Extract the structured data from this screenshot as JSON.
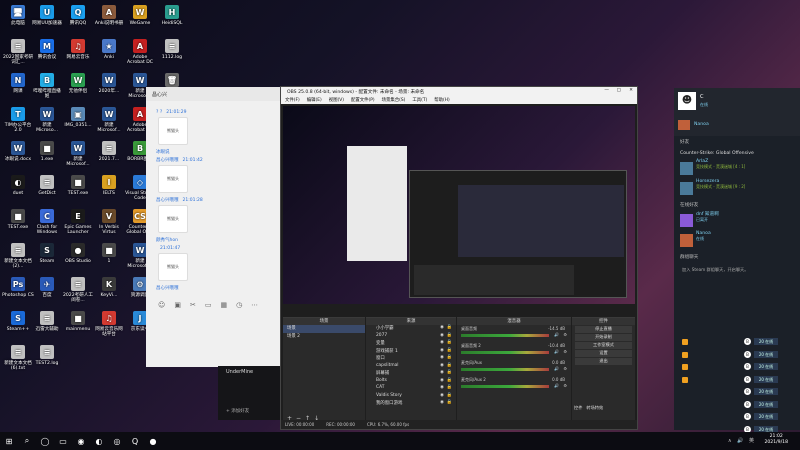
{
  "desktop": {
    "icons": [
      {
        "label": "此电脑",
        "glyph": "🖥",
        "color": "#3a7bd5"
      },
      {
        "label": "网易UU加速器",
        "glyph": "U",
        "color": "#1a9be8"
      },
      {
        "label": "腾讯QQ",
        "glyph": "Q",
        "color": "#1aa0f0"
      },
      {
        "label": "Anki说明书册",
        "glyph": "A",
        "color": "#8b5a3c"
      },
      {
        "label": "WeGame",
        "glyph": "W",
        "color": "#d9a020"
      },
      {
        "label": "HeidiSQL",
        "glyph": "H",
        "color": "#2a9d8f"
      },
      {
        "label": "2022国家考研词汇...",
        "glyph": "≡",
        "color": "#c0c0c0"
      },
      {
        "label": "腾讯会议",
        "glyph": "M",
        "color": "#1a6fe8"
      },
      {
        "label": "网易云音乐",
        "glyph": "♫",
        "color": "#d33a31"
      },
      {
        "label": "Anki",
        "glyph": "★",
        "color": "#4a78c8"
      },
      {
        "label": "Adobe Acrobat DC",
        "glyph": "A",
        "color": "#c42020"
      },
      {
        "label": "1112.log",
        "glyph": "≡",
        "color": "#c0c0c0"
      },
      {
        "label": "网课",
        "glyph": "N",
        "color": "#2266cc"
      },
      {
        "label": "哔哩哔哩直播姬",
        "glyph": "B",
        "color": "#23ade5"
      },
      {
        "label": "无他伴侣",
        "glyph": "W",
        "color": "#2aa050"
      },
      {
        "label": "2020年...",
        "glyph": "W",
        "color": "#2b5797"
      },
      {
        "label": "新建 Microsof...",
        "glyph": "W",
        "color": "#2b5797"
      },
      {
        "label": "回收站",
        "glyph": "🗑",
        "color": "#6a6a6a"
      },
      {
        "label": "TIM办公平台 2.0",
        "glyph": "T",
        "color": "#1a9be8"
      },
      {
        "label": "新建 Microso...",
        "glyph": "W",
        "color": "#2b5797"
      },
      {
        "label": "IMG_0351...",
        "glyph": "▣",
        "color": "#5a8ab8"
      },
      {
        "label": "新建 Microsof...",
        "glyph": "W",
        "color": "#2b5797"
      },
      {
        "label": "Adobe Acrobat DC",
        "glyph": "A",
        "color": "#c42020"
      },
      {
        "label": "Bongo Cat Mver",
        "glyph": "C",
        "color": "#333333"
      },
      {
        "label": "冰眼说.docx",
        "glyph": "W",
        "color": "#2b5797"
      },
      {
        "label": "1.exe",
        "glyph": "■",
        "color": "#4a4a4a"
      },
      {
        "label": "新建 Microsof...",
        "glyph": "W",
        "color": "#2b5797"
      },
      {
        "label": "2021.7...",
        "glyph": "≡",
        "color": "#c0c0c0"
      },
      {
        "label": "BORBR图片",
        "glyph": "B",
        "color": "#3a9a3a"
      },
      {
        "label": "Counter-Strike Global Off...",
        "glyph": "CS",
        "color": "#e39a2a"
      },
      {
        "label": "duet",
        "glyph": "◐",
        "color": "#1a1a1a"
      },
      {
        "label": "GetDict",
        "glyph": "≡",
        "color": "#c0c0c0"
      },
      {
        "label": "TEST.exe",
        "glyph": "■",
        "color": "#4a4a4a"
      },
      {
        "label": "IELTS",
        "glyph": "I",
        "color": "#d9a020"
      },
      {
        "label": "Visual Studio Code",
        "glyph": "◇",
        "color": "#2a7ad8"
      },
      {
        "label": "2.txt",
        "glyph": "≡",
        "color": "#c0c0c0"
      },
      {
        "label": "TEST.exe",
        "glyph": "■",
        "color": "#4a4a4a"
      },
      {
        "label": "Clash for Windows",
        "glyph": "C",
        "color": "#3a6ad8"
      },
      {
        "label": "Epic Games Launcher",
        "glyph": "E",
        "color": "#1a1a1a"
      },
      {
        "label": "In Verbis Virtus",
        "glyph": "V",
        "color": "#6a4a2a"
      },
      {
        "label": "Counter-S Global Off...",
        "glyph": "CS",
        "color": "#e39a2a"
      },
      {
        "label": "新建文本文档(3).txt",
        "glyph": "≡",
        "color": "#c0c0c0"
      },
      {
        "label": "新建文本文档(2)...",
        "glyph": "≡",
        "color": "#c0c0c0"
      },
      {
        "label": "Steam",
        "glyph": "S",
        "color": "#1b2838"
      },
      {
        "label": "OBS Studio",
        "glyph": "●",
        "color": "#2a2a2a"
      },
      {
        "label": "1",
        "glyph": "■",
        "color": "#4a4a4a"
      },
      {
        "label": "新建 Microsoft...",
        "glyph": "W",
        "color": "#2b5797"
      },
      {
        "label": "暴雪战网",
        "glyph": "B",
        "color": "#148eff"
      },
      {
        "label": "Photoshop CS",
        "glyph": "Ps",
        "color": "#2a5ab8"
      },
      {
        "label": "百度",
        "glyph": "✈",
        "color": "#2a5ab8"
      },
      {
        "label": "2022考研人工阅卷...",
        "glyph": "≡",
        "color": "#c0c0c0"
      },
      {
        "label": "KeyVi...",
        "glyph": "K",
        "color": "#3a3a3a"
      },
      {
        "label": "资源调度",
        "glyph": "⚙",
        "color": "#4a7ab8"
      },
      {
        "label": "Firevsl",
        "glyph": "F",
        "color": "#d83a2a"
      },
      {
        "label": "Steam++",
        "glyph": "S",
        "color": "#1a6ad8"
      },
      {
        "label": "迅雷大辅助",
        "glyph": "≡",
        "color": "#c0c0c0"
      },
      {
        "label": "mainmenu",
        "glyph": "■",
        "color": "#4a4a4a"
      },
      {
        "label": "网易云音乐网站平台",
        "glyph": "♫",
        "color": "#d33a31"
      },
      {
        "label": "京东读书",
        "glyph": "J",
        "color": "#2a8ad8"
      },
      {
        "label": "FACEIT",
        "glyph": "F",
        "color": "#f05a20"
      },
      {
        "label": "新建文本文档(6).txt",
        "glyph": "≡",
        "color": "#c0c0c0"
      },
      {
        "label": "TEST2.log",
        "glyph": "≡",
        "color": "#c0c0c0"
      }
    ]
  },
  "chat_window": {
    "title": "昌心兴",
    "messages": [
      {
        "name": "? ?",
        "time": "21:01:29",
        "sticker": "熊猫头"
      },
      {
        "name": "冰眼说",
        "time": ""
      },
      {
        "name": "昌心兴哦哦",
        "time": "21:01:42",
        "sticker": "熊猫头"
      },
      {
        "name": "昌心兴哦哦",
        "time": "21:01:28",
        "sticker": "熊猫头"
      },
      {
        "name": "颜秀气hon",
        "time": ""
      },
      {
        "name": "",
        "time": "21:01:47",
        "sticker": "熊猫头"
      },
      {
        "name": "昌心兴哦哦",
        "time": ""
      }
    ]
  },
  "obs": {
    "title": "OBS 25.0.8 (64-bit, windows) - 配置文件: 未命名 - 场景: 未命名",
    "menu": [
      "文件(F)",
      "编辑(E)",
      "视图(V)",
      "配置文件(P)",
      "场景集合(S)",
      "工具(T)",
      "帮助(H)"
    ],
    "panels": {
      "scenes": "场景",
      "sources": "来源",
      "mixer": "混音器",
      "transitions": "场景过渡",
      "controls": "控件"
    },
    "scenes": [
      "场景",
      "场景 2"
    ],
    "sources": [
      "小小学霸",
      "2077",
      "变量",
      "游戏捕获 1",
      "窗口",
      "capslitmal",
      "屏幕捕",
      "Bolts",
      "CAT",
      "Valdis Story",
      "我的窗口游戏"
    ],
    "mixer": [
      {
        "name": "桌面音频",
        "db": "-14.5 dB"
      },
      {
        "name": "桌面音频 2",
        "db": "-10.4 dB"
      },
      {
        "name": "麦克风/Aux",
        "db": "0.0 dB"
      },
      {
        "name": "麦克风/Aux 2",
        "db": "0.0 dB"
      }
    ],
    "controls": [
      "停止直播",
      "开始录制",
      "工作室模式",
      "设置",
      "退出"
    ],
    "transitions": "转场特效",
    "status": [
      "LIVE: 00:00:00",
      "REC: 00:00:00",
      "CPU: 6.7%, 60.00 fps"
    ]
  },
  "steam": {
    "username": "C",
    "status": "在线",
    "second_name": "Nanoa",
    "section_friends": "好友",
    "groups": [
      {
        "name": "Counter-Strike: Global Offensive",
        "friends": [
          {
            "name": "ArlaZ",
            "sub": "竞技模式 - 荒漠迷城 [4 : 1]"
          },
          {
            "name": "Horsezera",
            "sub": "竞技模式 - 荒漠迷城 [9 : 2]"
          }
        ]
      }
    ],
    "online_section": "在线好友",
    "online": [
      {
        "name": "dnf 知道啊",
        "sub": "已离开"
      },
      {
        "name": "Nanoa",
        "sub": "在线"
      }
    ],
    "group_chats": "群组聊天",
    "group_text": "加入 Steam 群组聊天，开启聊天。",
    "badges": [
      "20 在线",
      "20 在线",
      "20 在线",
      "20 在线",
      "20 在线",
      "20 在线",
      "20 在线",
      "20 在线"
    ]
  },
  "taskbar": {
    "time": "21:02",
    "date": "2021/9/18",
    "tray": "∧ 🔊 英"
  }
}
